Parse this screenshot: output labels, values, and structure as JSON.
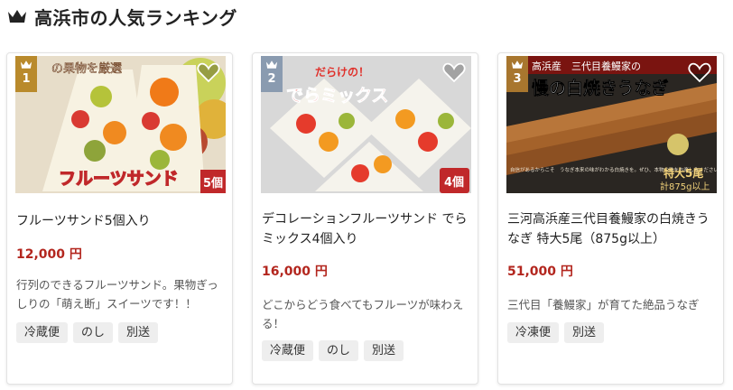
{
  "section": {
    "title": "高浜市の人気ランキング",
    "icon": "crown-icon"
  },
  "colors": {
    "price": "#b3261e",
    "rank_gold": "#b98a2c",
    "rank_silver": "#8a9bb0",
    "rank_bronze": "#a8762e",
    "tag_bg": "#eeeeee"
  },
  "products": [
    {
      "rank": "1",
      "name": "フルーツサンド5個入り",
      "price": "12,000 円",
      "description": "行列のできるフルーツサンド。果物ぎっしりの「萌え断」スイーツです！！",
      "tags": [
        "冷蔵便",
        "のし",
        "別送"
      ],
      "image": {
        "banner_top": "の果物を厳選",
        "banner_main": "フルーツサンド",
        "count_badge": "5個"
      }
    },
    {
      "rank": "2",
      "name": "デコレーションフルーツサンド でらミックス4個入り",
      "price": "16,000 円",
      "description": "どこからどう食べてもフルーツが味わえる！",
      "tags": [
        "冷蔵便",
        "のし",
        "別送"
      ],
      "image": {
        "banner_top": "だらけの！",
        "banner_main": "でらミックス",
        "count_badge": "4個"
      }
    },
    {
      "rank": "3",
      "name": "三河高浜産三代目養鰻家の白焼きうなぎ 特大5尾（875g以上）",
      "price": "51,000 円",
      "description": "三代目「養鰻家」が育てた絶品うなぎ",
      "tags": [
        "冷凍便",
        "別送"
      ],
      "image": {
        "banner_top": "高浜産　三代目養鰻家の",
        "banner_main": "慢の白焼きうなぎ",
        "small_text": "自信があるからこそ　うなぎ本来の味がわかる白焼きを。ぜひ、本物の味をお楽しみください。",
        "badge_line1": "特大5尾",
        "badge_line2": "計875g以上"
      }
    }
  ]
}
